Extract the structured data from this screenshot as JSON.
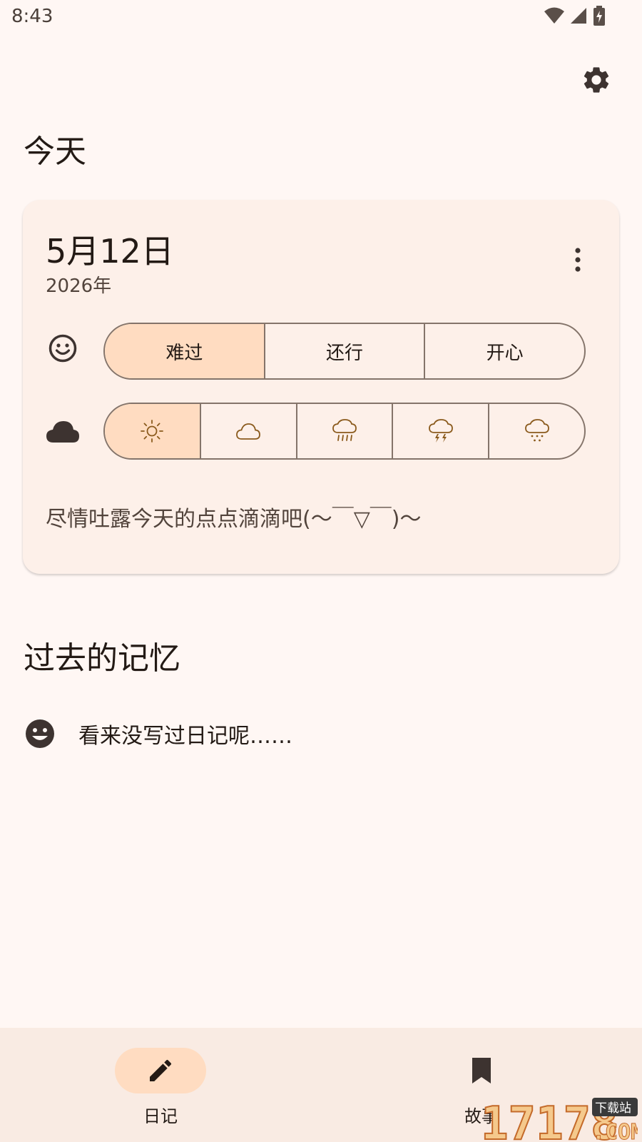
{
  "status_bar": {
    "time": "8:43",
    "icons": [
      "wifi-icon",
      "signal-icon",
      "battery-icon"
    ]
  },
  "header": {
    "settings_icon": "gear-icon"
  },
  "today": {
    "section_title": "今天",
    "card": {
      "date": "5月12日",
      "year": "2026年",
      "more_icon": "more-vert-icon",
      "mood": {
        "icon": "smile-outline-icon",
        "options": [
          "难过",
          "还行",
          "开心"
        ],
        "selected_index": 0
      },
      "weather": {
        "icon": "cloud-icon",
        "options": [
          "sun-icon",
          "cloud-icon",
          "rain-icon",
          "thunderstorm-icon",
          "snow-icon"
        ],
        "selected_index": 0
      },
      "placeholder": "尽情吐露今天的点点滴滴吧(～￣▽￣)～"
    }
  },
  "past": {
    "section_title": "过去的记忆",
    "empty_icon": "smile-filled-icon",
    "empty_text": "看来没写过日记呢……"
  },
  "bottom_nav": {
    "items": [
      {
        "label": "日记",
        "icon": "pencil-icon",
        "active": true
      },
      {
        "label": "故事",
        "icon": "bookmark-icon",
        "active": false
      }
    ]
  },
  "watermark": {
    "text": "17178",
    "subtext": "下载站",
    "suffix": ".COM"
  },
  "colors": {
    "background": "#fff7f4",
    "card": "#fdf0e9",
    "selected": "#ffdcc1",
    "outline": "#84746a",
    "nav_background": "#f9ebe3",
    "text": "#231a15"
  }
}
